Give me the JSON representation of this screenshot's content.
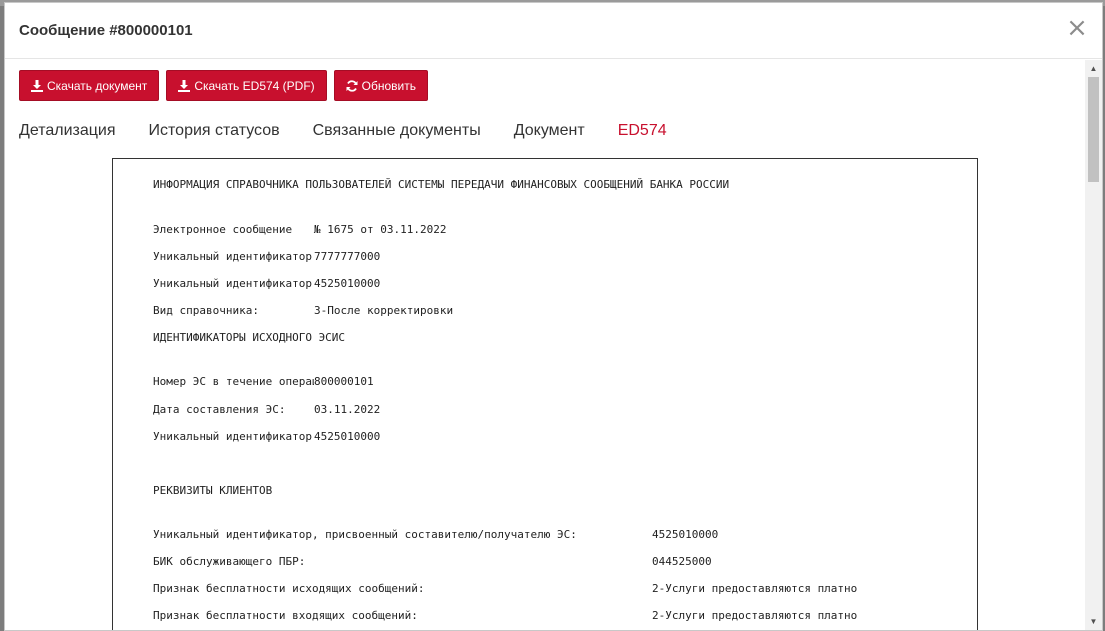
{
  "modal": {
    "title": "Сообщение #800000101",
    "close_label": "×"
  },
  "toolbar": {
    "buttons": [
      {
        "label": "Скачать документ",
        "icon": "download-icon"
      },
      {
        "label": "Скачать ED574 (PDF)",
        "icon": "download-icon"
      },
      {
        "label": "Обновить",
        "icon": "refresh-icon"
      }
    ]
  },
  "tabs": [
    {
      "label": "Детализация",
      "active": false
    },
    {
      "label": "История статусов",
      "active": false
    },
    {
      "label": "Связанные документы",
      "active": false
    },
    {
      "label": "Документ",
      "active": false
    },
    {
      "label": "ED574",
      "active": true
    }
  ],
  "document": {
    "heading": "ИНФОРМАЦИЯ СПРАВОЧНИКА ПОЛЬЗОВАТЕЛЕЙ СИСТЕМЫ ПЕРЕДАЧИ ФИНАНСОВЫХ СООБЩЕНИЙ БАНКА РОССИИ",
    "msg_label": "Электронное сообщение",
    "msg_value": "№ 1675 от 03.11.2022",
    "uid1_label": "Уникальный идентификатор",
    "uid1_value": "7777777000",
    "uid2_label": "Уникальный идентификатор",
    "uid2_value": "4525010000",
    "ref_type_label": "Вид справочника:",
    "ref_type_value": "3-После корректировки",
    "source_heading": "ИДЕНТИФИКАТОРЫ ИСХОДНОГО ЭСИС",
    "es_num_label": "Номер ЭС в течение операционного дня",
    "es_num_value": "800000101",
    "es_date_label": "Дата составления ЭС:",
    "es_date_value": "03.11.2022",
    "uid3_label": "Уникальный идентификатор",
    "uid3_value": "4525010000",
    "clients_heading": "РЕКВИЗИТЫ КЛИЕНТОВ",
    "rows": [
      {
        "label": "Уникальный идентификатор, присвоенный составителю/получателю ЭС:",
        "value": "4525010000"
      },
      {
        "label": "БИК обслуживающего ПБР:",
        "value": "044525000"
      },
      {
        "label": "Признак бесплатности исходящих сообщений:",
        "value": "2-Услуги предоставляются платно"
      },
      {
        "label": "Признак бесплатности входящих сообщений:",
        "value": "2-Услуги предоставляются платно"
      }
    ]
  },
  "colors": {
    "accent": "#c8102e",
    "text": "#333333"
  }
}
